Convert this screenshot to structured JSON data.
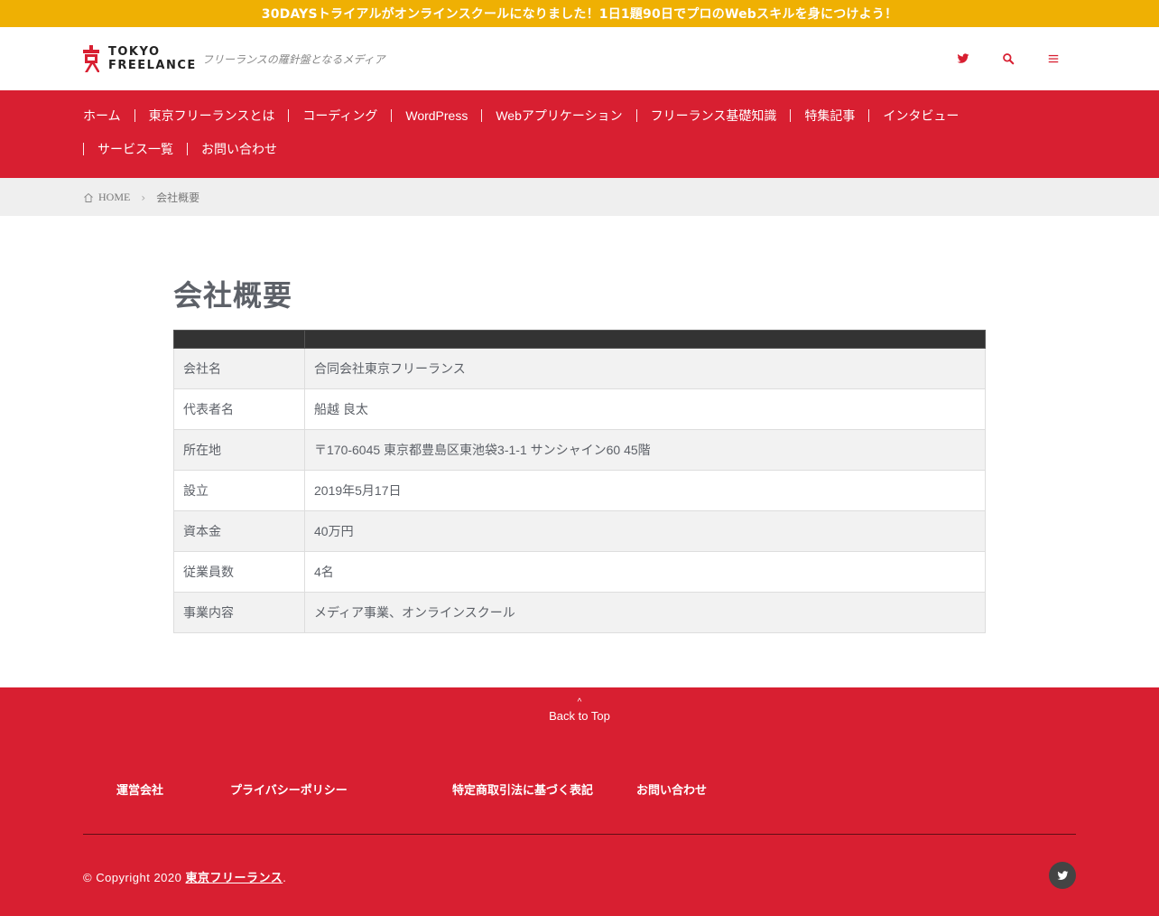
{
  "banner": {
    "text": "30DAYSトライアルがオンラインスクールになりました！1日1題90日でプロのWebスキルを身につけよう！"
  },
  "header": {
    "logo_line1": "TOKYO",
    "logo_line2": "FREELANCE",
    "tagline": "フリーランスの羅針盤となるメディア",
    "icons": [
      "twitter-icon",
      "search-icon",
      "menu-icon"
    ]
  },
  "nav": {
    "items": [
      "ホーム",
      "東京フリーランスとは",
      "コーディング",
      "WordPress",
      "Webアプリケーション",
      "フリーランス基礎知識",
      "特集記事",
      "インタビュー",
      "サービス一覧",
      "お問い合わせ"
    ]
  },
  "breadcrumb": {
    "home": "HOME",
    "current": "会社概要"
  },
  "main": {
    "title": "会社概要",
    "rows": [
      {
        "label": "会社名",
        "value": "合同会社東京フリーランス"
      },
      {
        "label": "代表者名",
        "value": "船越 良太"
      },
      {
        "label": "所在地",
        "value": "〒170-6045 東京都豊島区東池袋3-1-1 サンシャイン60 45階"
      },
      {
        "label": "設立",
        "value": "2019年5月17日"
      },
      {
        "label": "資本金",
        "value": "40万円"
      },
      {
        "label": "従業員数",
        "value": "4名"
      },
      {
        "label": "事業内容",
        "value": "メディア事業、オンラインスクール"
      }
    ]
  },
  "footer": {
    "back_to_top": "Back to Top",
    "links": [
      "運営会社",
      "プライバシーポリシー",
      "特定商取引法に基づく表記",
      "お問い合わせ"
    ],
    "copyright_prefix": "© Copyright 2020 ",
    "copyright_link": "東京フリーランス",
    "copyright_suffix": "."
  },
  "colors": {
    "brand_red": "#d81f31",
    "banner_yellow": "#efb003",
    "table_header": "#333333"
  }
}
